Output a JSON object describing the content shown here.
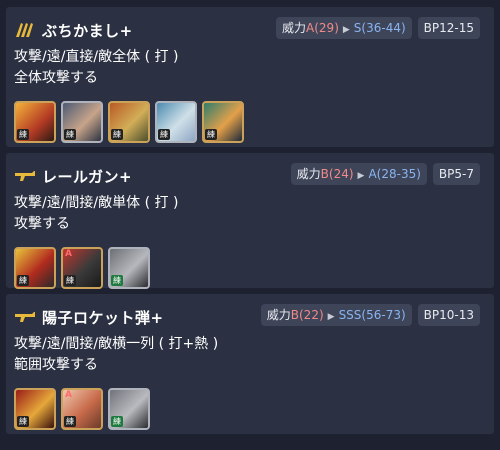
{
  "skills": [
    {
      "name": "ぶちかまし+",
      "icon": "gold-claw-icon",
      "power_label": "威力",
      "from": "A(29)",
      "to": "S(36-44)",
      "bp": "BP12-15",
      "line1": "攻撃/遠/直接/敵全体 ( 打 )",
      "line2": "全体攻撃する",
      "units": [
        {
          "label": "練",
          "tag": "",
          "colors": [
            "#f4b13a",
            "#b33a24",
            "#2b1a13"
          ],
          "border": "gold"
        },
        {
          "label": "練",
          "tag": "",
          "colors": [
            "#4c5b74",
            "#c7a48a",
            "#2d3342"
          ],
          "border": "silver"
        },
        {
          "label": "練",
          "tag": "",
          "colors": [
            "#b95a25",
            "#d2ae58",
            "#4b4f2c"
          ],
          "border": "gold"
        },
        {
          "label": "練",
          "tag": "",
          "colors": [
            "#4b8bb0",
            "#cfe0e8",
            "#8fa6c4"
          ],
          "border": "silver"
        },
        {
          "label": "練",
          "tag": "",
          "colors": [
            "#2f7d6d",
            "#e3a04a",
            "#1e2a3a"
          ],
          "border": "gold"
        }
      ]
    },
    {
      "name": "レールガン+",
      "icon": "gold-gun-icon",
      "power_label": "威力",
      "from": "B(24)",
      "to": "A(28-35)",
      "bp": "BP5-7",
      "line1": "攻撃/遠/間接/敵単体 ( 打 )",
      "line2": "攻撃する",
      "units": [
        {
          "label": "練",
          "tag": "",
          "colors": [
            "#e8c23b",
            "#b12b1e",
            "#2a2a2a"
          ],
          "border": "gold"
        },
        {
          "label": "練",
          "tag": "A",
          "colors": [
            "#c1372e",
            "#3a3a3a",
            "#1a1a1a"
          ],
          "border": "gold"
        },
        {
          "label": "練",
          "tag": "",
          "colors": [
            "#6c6f75",
            "#b6b8bd",
            "#2a2c30"
          ],
          "border": "silver",
          "green": true
        }
      ]
    },
    {
      "name": "陽子ロケット弾+",
      "icon": "gold-gun-icon",
      "power_label": "威力",
      "from": "B(22)",
      "to": "SSS(56-73)",
      "bp": "BP10-13",
      "line1": "攻撃/遠/間接/敵横一列 ( 打+熱 )",
      "line2": "範囲攻撃する",
      "units": [
        {
          "label": "練",
          "tag": "",
          "colors": [
            "#9b1c17",
            "#e5a83a",
            "#3a0f0c"
          ],
          "border": "gold"
        },
        {
          "label": "練",
          "tag": "A",
          "colors": [
            "#f0c7b0",
            "#c76a4a",
            "#6b3a2a"
          ],
          "border": "gold"
        },
        {
          "label": "練",
          "tag": "",
          "colors": [
            "#70737a",
            "#b9bbbf",
            "#2a2c30"
          ],
          "border": "silver",
          "green": true
        }
      ]
    }
  ]
}
